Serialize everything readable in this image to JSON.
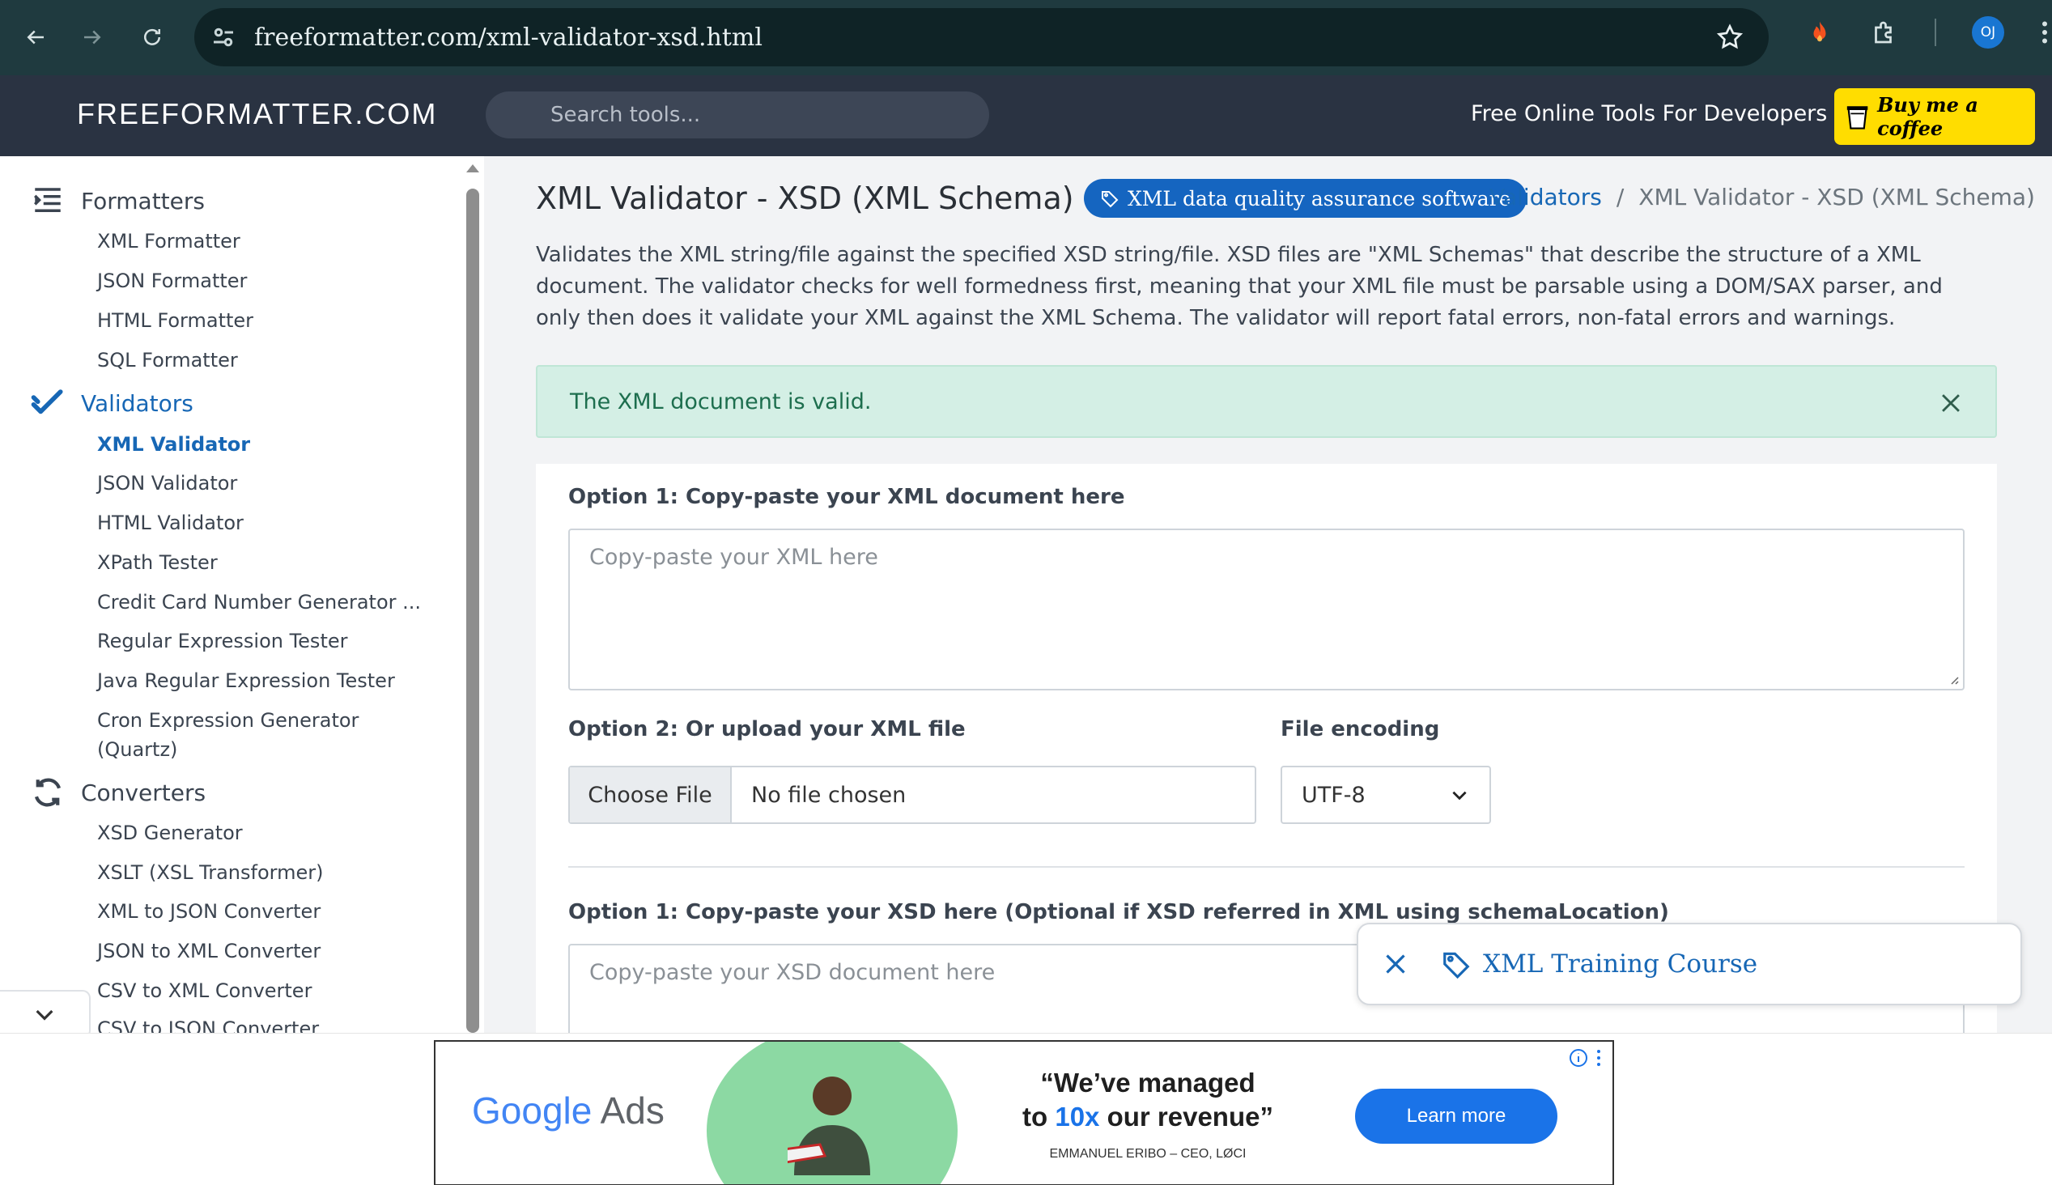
{
  "browser": {
    "url": "freeformatter.com/xml-validator-xsd.html",
    "avatar_initials": "OJ"
  },
  "header": {
    "logo": "FREEFORMATTER.COM",
    "search_placeholder": "Search tools...",
    "tagline": "Free Online Tools For Developers",
    "coffee_label": "Buy me a coffee"
  },
  "sidebar": {
    "groups": [
      {
        "label": "Formatters",
        "items": [
          "XML Formatter",
          "JSON Formatter",
          "HTML Formatter",
          "SQL Formatter"
        ]
      },
      {
        "label": "Validators",
        "items": [
          "XML Validator",
          "JSON Validator",
          "HTML Validator",
          "XPath Tester",
          "Credit Card Number Generator ...",
          "Regular Expression Tester",
          "Java Regular Expression Tester",
          "Cron Expression Generator",
          "(Quartz)"
        ]
      },
      {
        "label": "Converters",
        "items": [
          "XSD Generator",
          "XSLT (XSL Transformer)",
          "XML to JSON Converter",
          "JSON to XML Converter",
          "CSV to XML Converter",
          "CSV to JSON Converter"
        ]
      }
    ],
    "active_group": "Validators",
    "active_item": "XML Validator"
  },
  "main": {
    "title": "XML Validator - XSD (XML Schema)",
    "badge": "XML data quality assurance software",
    "breadcrumb": {
      "link": "Validators",
      "separator": "/",
      "current": "XML Validator - XSD (XML Schema)"
    },
    "description": "Validates the XML string/file against the specified XSD string/file. XSD files are \"XML Schemas\" that describe the structure of a XML document. The validator checks for well formedness first, meaning that your XML file must be parsable using a DOM/SAX parser, and only then does it validate your XML against the XML Schema. The validator will report fatal errors, non-fatal errors and warnings.",
    "alert": "The XML document is valid.",
    "xml_label": "Option 1: Copy-paste your XML document here",
    "xml_placeholder": "Copy-paste your XML here",
    "upload_label": "Option 2: Or upload your XML file",
    "choose_file": "Choose File",
    "no_file": "No file chosen",
    "encoding_label": "File encoding",
    "encoding_value": "UTF-8",
    "xsd_label": "Option 1: Copy-paste your XSD here (Optional if XSD referred in XML using schemaLocation)",
    "xsd_placeholder": "Copy-paste your XSD document here"
  },
  "promo": {
    "label": "XML Training Course"
  },
  "ad": {
    "logo_g": "Google",
    "logo_ads": "Ads",
    "quote_1": "“We’ve managed",
    "quote_2a": "to ",
    "quote_2b": "10x",
    "quote_2c": " our revenue”",
    "attribution": "EMMANUEL ERIBO – CEO, LØCI",
    "cta": "Learn more"
  },
  "colors": {
    "chrome": "#1f3a3f",
    "header": "#2a3342",
    "accent": "#1767b5",
    "success_bg": "#d4efe5",
    "coffee": "#ffdd00"
  }
}
